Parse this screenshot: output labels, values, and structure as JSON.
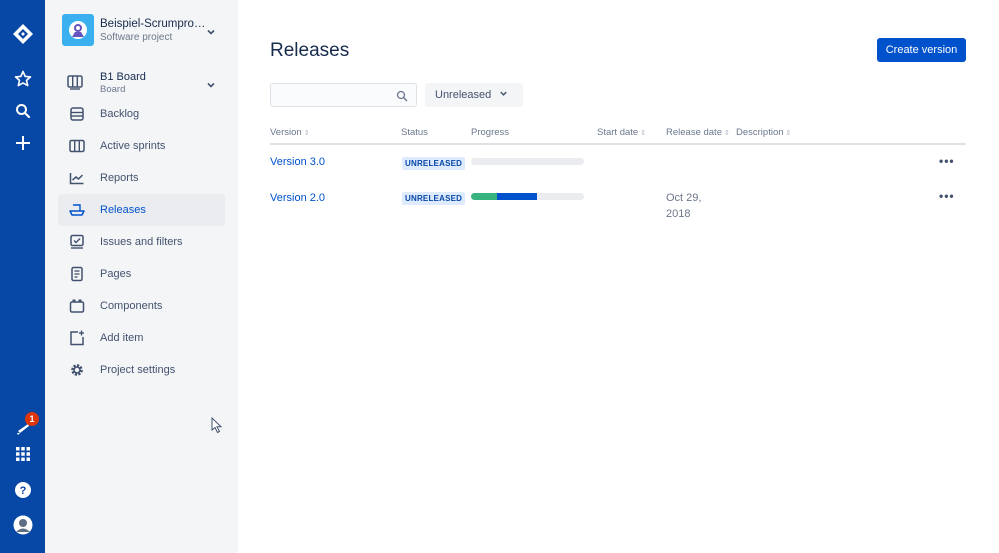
{
  "global_nav": {
    "icons": [
      "jira-logo-icon",
      "star-icon",
      "search-icon",
      "plus-icon",
      "notifications-icon",
      "app-switcher-icon",
      "help-icon",
      "user-avatar"
    ],
    "notification_count": "1"
  },
  "project": {
    "name": "Beispiel-Scrumpro…",
    "type": "Software project"
  },
  "board": {
    "name": "B1 Board",
    "sub": "Board"
  },
  "sidebar": {
    "items": [
      {
        "label": "Backlog",
        "icon": "backlog-icon"
      },
      {
        "label": "Active sprints",
        "icon": "active-sprints-icon"
      },
      {
        "label": "Reports",
        "icon": "reports-icon"
      },
      {
        "label": "Releases",
        "icon": "releases-icon",
        "active": true
      },
      {
        "label": "Issues and filters",
        "icon": "issues-icon"
      },
      {
        "label": "Pages",
        "icon": "pages-icon"
      },
      {
        "label": "Components",
        "icon": "components-icon"
      },
      {
        "label": "Add item",
        "icon": "add-item-icon"
      },
      {
        "label": "Project settings",
        "icon": "settings-gear-icon"
      }
    ]
  },
  "main": {
    "title": "Releases",
    "create_button": "Create version",
    "search_placeholder": "",
    "filter_label": "Unreleased",
    "columns": [
      "Version",
      "Status",
      "Progress",
      "Start date",
      "Release date",
      "Description"
    ],
    "rows": [
      {
        "version": "Version 3.0",
        "status": "UNRELEASED",
        "progress_done": 0,
        "progress_inprogress": 0,
        "start_date": "",
        "release_date": "",
        "description": ""
      },
      {
        "version": "Version 2.0",
        "status": "UNRELEASED",
        "progress_done": 0.23,
        "progress_inprogress": 0.35,
        "start_date": "",
        "release_date": "Oct 29, 2018",
        "description": ""
      }
    ]
  },
  "colors": {
    "global_nav": "#0747a6",
    "accent": "#0052cc",
    "done": "#36b37e",
    "lozenge_bg": "#deebff"
  }
}
